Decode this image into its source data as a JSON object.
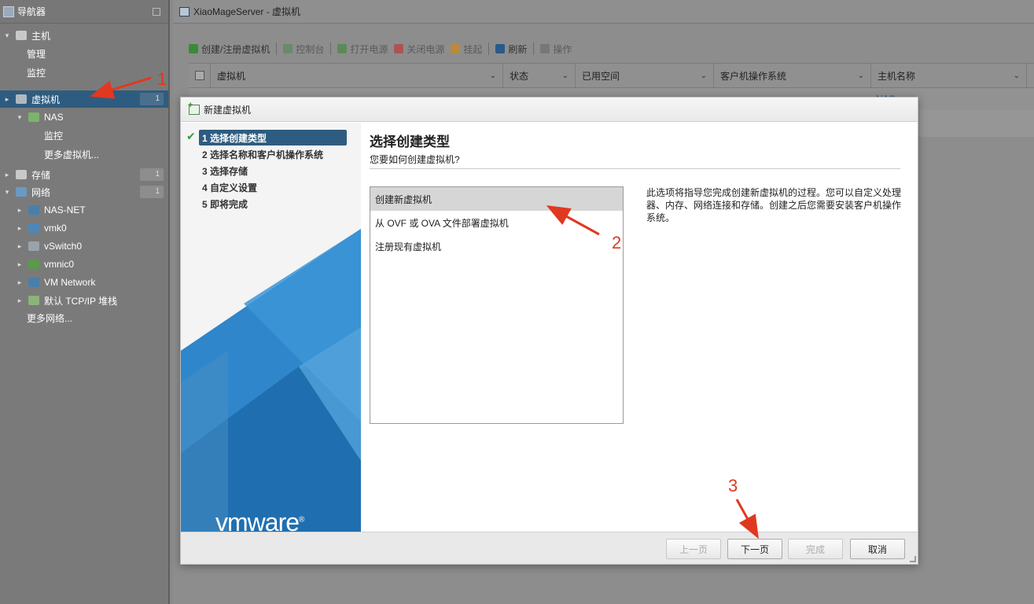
{
  "navigator": {
    "title": "导航器",
    "items": [
      {
        "label": "主机",
        "level": 0,
        "expand": "▾",
        "icon_color": "#c9c9c9"
      },
      {
        "label": "管理",
        "level": 1
      },
      {
        "label": "监控",
        "level": 1
      },
      {
        "label": "虚拟机",
        "level": 0,
        "expand": "▸",
        "badge": "1",
        "selected": true,
        "icon_color": "#b0b8c0"
      },
      {
        "label": "NAS",
        "level": 1,
        "expand": "▾",
        "icon_color": "#7ab46a"
      },
      {
        "label": "监控",
        "level": 2
      },
      {
        "label": "更多虚拟机...",
        "level": 2
      },
      {
        "label": "存储",
        "level": 0,
        "expand": "▸",
        "badge": "1",
        "icon_color": "#c9c9c9"
      },
      {
        "label": "网络",
        "level": 0,
        "expand": "▾",
        "badge": "1",
        "icon_color": "#6a9ac4"
      },
      {
        "label": "NAS-NET",
        "level": 1,
        "expand": "▸",
        "icon_color": "#4a7faa"
      },
      {
        "label": "vmk0",
        "level": 1,
        "expand": "▸",
        "icon_color": "#4f86b8"
      },
      {
        "label": "vSwitch0",
        "level": 1,
        "expand": "▸",
        "icon_color": "#9aa3ac"
      },
      {
        "label": "vmnic0",
        "level": 1,
        "expand": "▸",
        "icon_color": "#5a9a4a"
      },
      {
        "label": "VM Network",
        "level": 1,
        "expand": "▸",
        "icon_color": "#4a7faa"
      },
      {
        "label": "默认 TCP/IP 堆栈",
        "level": 1,
        "expand": "▸",
        "icon_color": "#8ab47a"
      },
      {
        "label": "更多网络...",
        "level": 1
      }
    ]
  },
  "main": {
    "title": "XiaoMageServer - 虚拟机",
    "toolbar": [
      {
        "label": "创建/注册虚拟机",
        "icon": "create-vm-icon",
        "color": "#3a8a3a",
        "disabled": false
      },
      {
        "label": "控制台",
        "icon": "console-icon",
        "color": "#6a8a6a",
        "disabled": true
      },
      {
        "label": "打开电源",
        "icon": "power-on-icon",
        "color": "#5a8a5a",
        "disabled": true
      },
      {
        "label": "关闭电源",
        "icon": "power-off-icon",
        "color": "#a55",
        "disabled": true
      },
      {
        "label": "挂起",
        "icon": "suspend-icon",
        "color": "#b98a3a",
        "disabled": true
      },
      {
        "label": "刷新",
        "icon": "refresh-icon",
        "color": "#2a5a8a",
        "disabled": false
      },
      {
        "label": "操作",
        "icon": "gear-icon",
        "color": "#777",
        "disabled": true
      }
    ],
    "columns": [
      "虚拟机",
      "状态",
      "已用空间",
      "客户机操作系统",
      "主机名称"
    ],
    "row_hostname": "-NAS"
  },
  "modal": {
    "title": "新建虚拟机",
    "steps": [
      "1 选择创建类型",
      "2 选择名称和客户机操作系统",
      "3 选择存储",
      "4 自定义设置",
      "5 即将完成"
    ],
    "active_step": 0,
    "logo_text": "vmware",
    "logo_mark": "®",
    "content_title": "选择创建类型",
    "content_subtitle": "您要如何创建虚拟机?",
    "options": [
      "创建新虚拟机",
      "从 OVF 或 OVA 文件部署虚拟机",
      "注册现有虚拟机"
    ],
    "selected_option": 0,
    "description": "此选项将指导您完成创建新虚拟机的过程。您可以自定义处理器、内存、网络连接和存储。创建之后您需要安装客户机操作系统。",
    "buttons": {
      "prev": "上一页",
      "next": "下一页",
      "finish": "完成",
      "cancel": "取消"
    }
  },
  "annotations": [
    "1",
    "2",
    "3"
  ],
  "colors": {
    "accent": "#2e5c80",
    "annotation": "#e0391f",
    "vmware_blue": "#1d75bc"
  }
}
